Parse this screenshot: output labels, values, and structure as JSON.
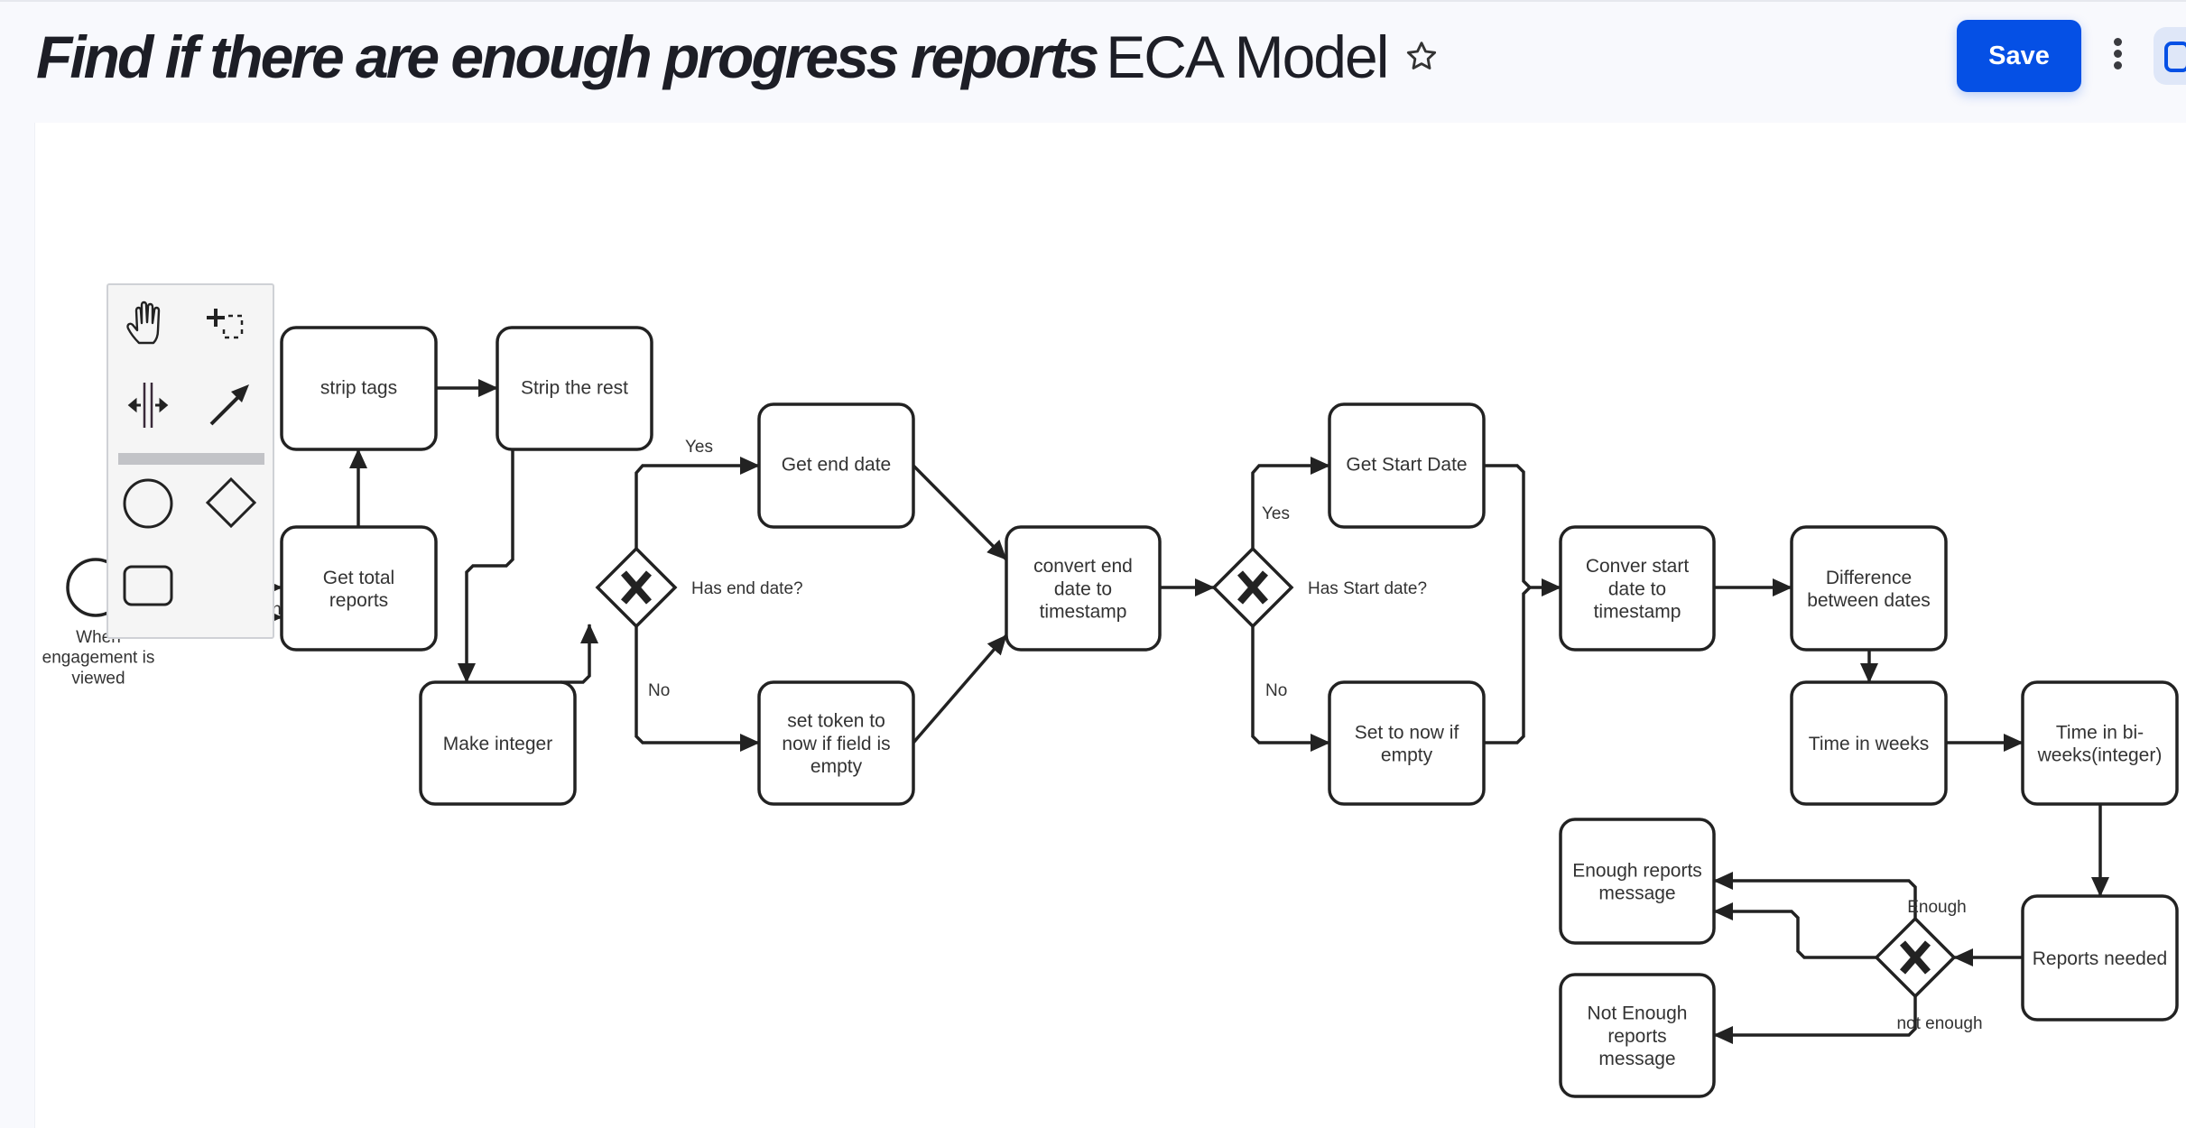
{
  "header": {
    "title_italic": "Find if there are enough progress reports",
    "title_plain": "ECA Model",
    "star_icon": "star-outline-icon",
    "save_label": "Save",
    "more_icon": "kebab-menu-icon",
    "panel_toggle_icon": "side-panel-icon"
  },
  "palette": {
    "tools": [
      {
        "name": "hand-tool",
        "icon": "hand-icon"
      },
      {
        "name": "lasso-tool",
        "icon": "lasso-select-icon"
      },
      {
        "name": "space-tool",
        "icon": "space-tool-icon"
      },
      {
        "name": "connect-tool",
        "icon": "arrow-connect-icon"
      },
      {
        "name": "create-event",
        "icon": "circle-event-icon"
      },
      {
        "name": "create-gateway",
        "icon": "diamond-gateway-icon"
      },
      {
        "name": "create-task",
        "icon": "rounded-rect-task-icon"
      }
    ]
  },
  "diagram": {
    "start_event": {
      "label_lines": [
        "When",
        "engagement is",
        "viewed"
      ]
    },
    "tasks": {
      "get_total_reports": [
        "Get total",
        "reports"
      ],
      "strip_tags": [
        "strip tags"
      ],
      "strip_the_rest": [
        "Strip the rest"
      ],
      "make_integer": [
        "Make integer"
      ],
      "get_end_date": [
        "Get end date"
      ],
      "set_token": [
        "set token to",
        "now if field is",
        "empty"
      ],
      "convert_end_date": [
        "convert end",
        "date to",
        "timestamp"
      ],
      "get_start_date": [
        "Get Start Date"
      ],
      "set_to_now": [
        "Set to now if",
        "empty"
      ],
      "conver_start_date": [
        "Conver start",
        "date to",
        "timestamp"
      ],
      "difference": [
        "Difference",
        "between dates"
      ],
      "time_in_weeks": [
        "Time in weeks"
      ],
      "time_in_biweeks": [
        "Time in bi-",
        "weeks(integer)"
      ],
      "reports_needed": [
        "Reports needed"
      ],
      "enough_message": [
        "Enough reports",
        "message"
      ],
      "not_enough_message": [
        "Not Enough",
        "reports",
        "message"
      ]
    },
    "gateways": {
      "has_end_date": "Has end date?",
      "has_start_date": "Has Start date?",
      "enough_check": ""
    },
    "flow_labels": {
      "is_reviewer": "is reviewer",
      "is_admin": "is admin",
      "end_yes": "Yes",
      "end_no": "No",
      "start_yes": "Yes",
      "start_no": "No",
      "enough": "Enough",
      "not_enough": "not enough"
    }
  }
}
